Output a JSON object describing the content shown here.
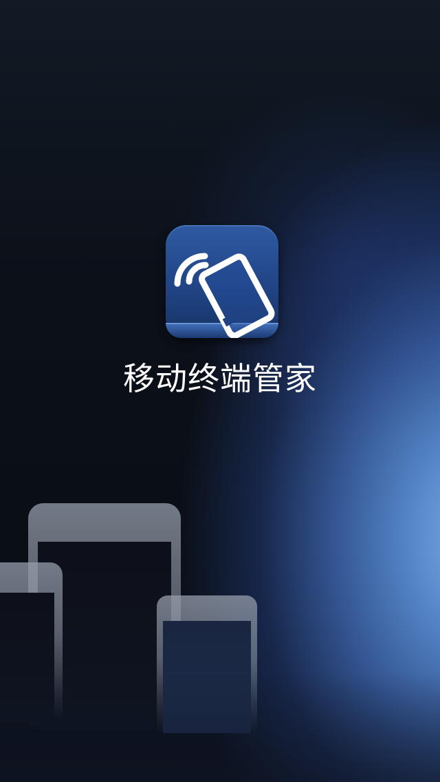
{
  "app": {
    "title": "移动终端管家",
    "icon": "phone-signal-icon"
  },
  "colors": {
    "accent": "#2e5aa2",
    "glow": "#7eb0e8",
    "background": "#0b101a"
  }
}
